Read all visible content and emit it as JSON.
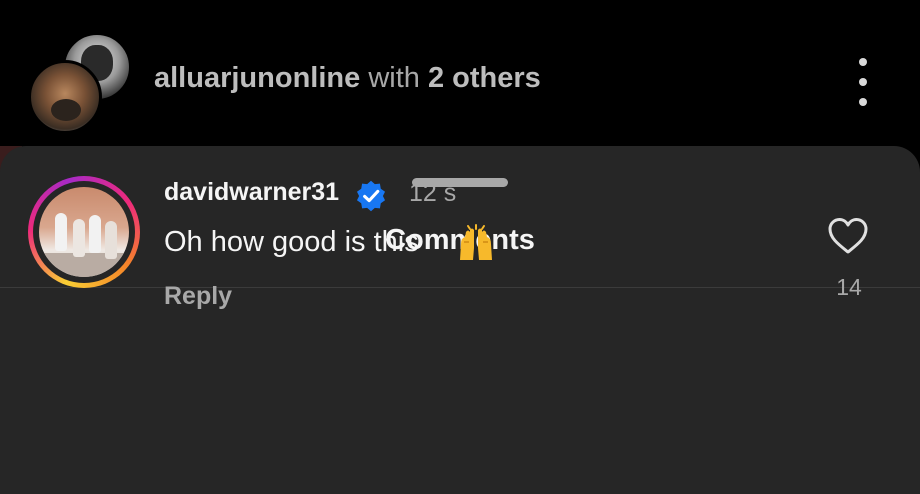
{
  "header": {
    "username": "alluarjunonline",
    "with_text": "with",
    "others_text": "2 others"
  },
  "comments_sheet": {
    "title": "Comments",
    "comments": [
      {
        "username": "davidwarner31",
        "verified": true,
        "timestamp": "12 s",
        "text": "Oh how good is this",
        "emoji": "raising-hands",
        "reply_label": "Reply",
        "like_count": "14"
      }
    ]
  },
  "colors": {
    "sheet_background": "#262626",
    "verified_badge": "#1877f2",
    "secondary_text": "#a8a8a8"
  }
}
